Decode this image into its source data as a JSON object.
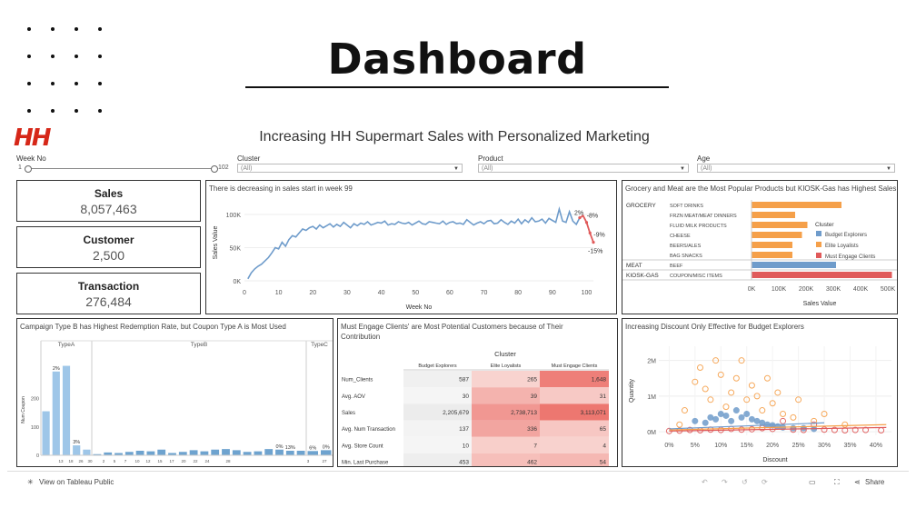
{
  "hero": {
    "title": "Dashboard"
  },
  "viz": {
    "brand": "HH",
    "title": "Increasing HH Supermart Sales with Personalized Marketing"
  },
  "filters": {
    "week": {
      "label": "Week No",
      "min": "1",
      "max": "102"
    },
    "cluster": {
      "label": "Cluster",
      "value": "(All)"
    },
    "product": {
      "label": "Product",
      "value": "(All)"
    },
    "age": {
      "label": "Age",
      "value": "(All)"
    }
  },
  "kpis": [
    {
      "label": "Sales",
      "value": "8,057,463"
    },
    {
      "label": "Customer",
      "value": "2,500"
    },
    {
      "label": "Transaction",
      "value": "276,484"
    }
  ],
  "line_panel": {
    "title": "There is decreasing in sales start in week 99"
  },
  "product_panel": {
    "title": "Grocery and Meat are the Most Popular Products but KIOSK-Gas has Highest Sales"
  },
  "campaign_panel": {
    "title": "Campaign Type B has Highest Redemption Rate, but Coupon Type A is Most Used"
  },
  "table_panel": {
    "title": "Must Engage Clients' are Most Potential Customers because of Their Contribution",
    "group_label": "Cluster",
    "columns": [
      "Budget Explorers",
      "Elite Loyalists",
      "Must Engage Clients"
    ],
    "rows": [
      {
        "label": "Num_Clients",
        "values": [
          "587",
          "265",
          "1,648"
        ]
      },
      {
        "label": "Avg. AOV",
        "values": [
          "30",
          "39",
          "31"
        ]
      },
      {
        "label": "Sales",
        "values": [
          "2,205,679",
          "2,738,713",
          "3,113,071"
        ]
      },
      {
        "label": "Avg. Num Transaction",
        "values": [
          "137",
          "336",
          "65"
        ]
      },
      {
        "label": "Avg. Store Count",
        "values": [
          "10",
          "7",
          "4"
        ]
      },
      {
        "label": "Min. Last Purchase",
        "values": [
          "453",
          "462",
          "54"
        ]
      }
    ]
  },
  "scatter_panel": {
    "title": "Increasing Discount Only Effective for Budget Explorers"
  },
  "toolbar": {
    "view_label": "View on Tableau Public",
    "share_label": "Share"
  },
  "colors": {
    "blue": "#6f9ccb",
    "orange": "#f5a04a",
    "red": "#e05a5a",
    "bar_light": "#9ec6e8",
    "bar_dark": "#5b8fbf"
  },
  "chart_data": [
    {
      "type": "line",
      "title": "There is decreasing in sales start in week 99",
      "xlabel": "Week No",
      "ylabel": "Sales Value",
      "xticks": [
        "0",
        "10",
        "20",
        "30",
        "40",
        "50",
        "60",
        "70",
        "80",
        "90",
        "100"
      ],
      "yticks": [
        "0K",
        "50K",
        "100K"
      ],
      "xlim": [
        0,
        102
      ],
      "ylim": [
        0,
        115000
      ],
      "x": [
        1,
        2,
        3,
        4,
        5,
        6,
        7,
        8,
        9,
        10,
        11,
        12,
        13,
        14,
        15,
        16,
        17,
        18,
        19,
        20,
        21,
        22,
        23,
        24,
        25,
        26,
        27,
        28,
        29,
        30,
        31,
        32,
        33,
        34,
        35,
        36,
        37,
        38,
        39,
        40,
        41,
        42,
        43,
        44,
        45,
        46,
        47,
        48,
        49,
        50,
        51,
        52,
        53,
        54,
        55,
        56,
        57,
        58,
        59,
        60,
        61,
        62,
        63,
        64,
        65,
        66,
        67,
        68,
        69,
        70,
        71,
        72,
        73,
        74,
        75,
        76,
        77,
        78,
        79,
        80,
        81,
        82,
        83,
        84,
        85,
        86,
        87,
        88,
        89,
        90,
        91,
        92,
        93,
        94,
        95,
        96,
        97,
        98,
        99,
        100,
        101,
        102
      ],
      "y": [
        3000,
        12000,
        18000,
        22000,
        25000,
        30000,
        35000,
        42000,
        50000,
        48000,
        58000,
        52000,
        62000,
        68000,
        66000,
        72000,
        78000,
        76000,
        80000,
        82000,
        78000,
        84000,
        80000,
        83000,
        86000,
        81000,
        85000,
        82000,
        88000,
        84000,
        80000,
        86000,
        83000,
        87000,
        85000,
        89000,
        84000,
        86000,
        88000,
        87000,
        90000,
        84000,
        86000,
        85000,
        89000,
        87000,
        86000,
        88000,
        84000,
        87000,
        90000,
        86000,
        85000,
        89000,
        88000,
        87000,
        86000,
        90000,
        85000,
        88000,
        89000,
        86000,
        87000,
        85000,
        92000,
        88000,
        84000,
        87000,
        89000,
        86000,
        90000,
        91000,
        86000,
        87000,
        92000,
        88000,
        85000,
        90000,
        87000,
        93000,
        86000,
        92000,
        88000,
        95000,
        89000,
        90000,
        93000,
        87000,
        94000,
        91000,
        88000,
        108000,
        90000,
        88000,
        104000,
        90000,
        85000,
        95000,
        98000,
        88000,
        72000,
        58000
      ],
      "annotations": [
        "2%",
        "-8%",
        "-9%",
        "-15%"
      ]
    },
    {
      "type": "bar",
      "title": "Grocery and Meat are the Most Popular Products but KIOSK-Gas has Highest Sales",
      "xlabel": "Sales Value",
      "xticks": [
        "0K",
        "100K",
        "200K",
        "300K",
        "400K",
        "500K"
      ],
      "xlim": [
        0,
        500000
      ],
      "legend_title": "Cluster",
      "legend": [
        "Budget Explorers",
        "Elite Loyalists",
        "Must Engage Clients"
      ],
      "legend_position": "right",
      "groups": [
        {
          "name": "GROCERY",
          "items": [
            {
              "label": "SOFT DRINKS",
              "value": 330000,
              "series": "Elite Loyalists"
            },
            {
              "label": "FRZN MEAT/MEAT DINNERS",
              "value": 160000,
              "series": "Elite Loyalists"
            },
            {
              "label": "FLUID MILK PRODUCTS",
              "value": 205000,
              "series": "Elite Loyalists"
            },
            {
              "label": "CHEESE",
              "value": 185000,
              "series": "Elite Loyalists"
            },
            {
              "label": "BEERS/ALES",
              "value": 150000,
              "series": "Elite Loyalists"
            },
            {
              "label": "BAG SNACKS",
              "value": 150000,
              "series": "Elite Loyalists"
            }
          ]
        },
        {
          "name": "MEAT",
          "items": [
            {
              "label": "BEEF",
              "value": 310000,
              "series": "Budget Explorers"
            }
          ]
        },
        {
          "name": "KIOSK-GAS",
          "items": [
            {
              "label": "COUPON/MISC ITEMS",
              "value": 515000,
              "series": "Must Engage Clients"
            }
          ]
        }
      ]
    },
    {
      "type": "bar",
      "title": "Campaign Type B has Highest Redemption Rate, but Coupon Type A is Most Used",
      "ylabel": "Num Coupon",
      "yticks": [
        "0",
        "100",
        "200"
      ],
      "ylim": [
        0,
        320
      ],
      "panels": [
        {
          "name": "TypeA",
          "categories": [
            "8",
            "13",
            "18",
            "26",
            "30"
          ],
          "values": [
            155,
            295,
            315,
            35,
            20
          ],
          "labels": {
            "1": "2%",
            "3": "3%"
          }
        },
        {
          "name": "TypeB",
          "categories": [
            "2",
            "5",
            "6",
            "7",
            "9",
            "10",
            "11",
            "12",
            "14",
            "15",
            "16",
            "17",
            "19",
            "20",
            "21",
            "22",
            "23",
            "24",
            "25",
            "28"
          ],
          "values": [
            4,
            10,
            8,
            12,
            16,
            14,
            20,
            8,
            12,
            18,
            14,
            20,
            22,
            18,
            12,
            14,
            22,
            20,
            16,
            16
          ],
          "labels": {
            "17": "0%",
            "18": "13%"
          }
        },
        {
          "name": "TypeC",
          "categories": [
            "3",
            "27"
          ],
          "values": [
            15,
            18
          ],
          "labels": {
            "0": "6%",
            "1": "0%"
          }
        }
      ],
      "visible_tick_labels": [
        "13",
        "18",
        "26",
        "30",
        "2",
        "5",
        "7",
        "10",
        "12",
        "15",
        "17",
        "20",
        "22",
        "24",
        "28",
        "3",
        "27"
      ]
    },
    {
      "type": "scatter",
      "title": "Increasing Discount Only Effective for Budget Explorers",
      "xlabel": "Discount",
      "ylabel": "Quantity",
      "xticks": [
        "0%",
        "5%",
        "10%",
        "15%",
        "20%",
        "25%",
        "30%",
        "35%",
        "40%"
      ],
      "yticks": [
        "0M",
        "1M",
        "2M"
      ],
      "xlim": [
        -0.02,
        0.43
      ],
      "ylim": [
        -0.1,
        2.4
      ],
      "series": [
        {
          "name": "Budget Explorers",
          "points": [
            [
              0.05,
              0.3
            ],
            [
              0.07,
              0.25
            ],
            [
              0.08,
              0.4
            ],
            [
              0.09,
              0.35
            ],
            [
              0.1,
              0.5
            ],
            [
              0.11,
              0.45
            ],
            [
              0.12,
              0.3
            ],
            [
              0.13,
              0.6
            ],
            [
              0.14,
              0.4
            ],
            [
              0.15,
              0.5
            ],
            [
              0.16,
              0.35
            ],
            [
              0.17,
              0.3
            ],
            [
              0.18,
              0.25
            ],
            [
              0.19,
              0.2
            ],
            [
              0.2,
              0.18
            ],
            [
              0.21,
              0.15
            ],
            [
              0.22,
              0.12
            ],
            [
              0.24,
              0.1
            ],
            [
              0.26,
              0.1
            ],
            [
              0.28,
              0.08
            ]
          ]
        },
        {
          "name": "Elite Loyalists",
          "points": [
            [
              0.02,
              0.2
            ],
            [
              0.03,
              0.6
            ],
            [
              0.05,
              1.4
            ],
            [
              0.06,
              1.8
            ],
            [
              0.07,
              1.2
            ],
            [
              0.08,
              0.9
            ],
            [
              0.09,
              2.0
            ],
            [
              0.1,
              1.6
            ],
            [
              0.11,
              0.7
            ],
            [
              0.12,
              1.1
            ],
            [
              0.13,
              1.5
            ],
            [
              0.14,
              2.0
            ],
            [
              0.15,
              0.9
            ],
            [
              0.16,
              1.3
            ],
            [
              0.17,
              1.0
            ],
            [
              0.18,
              0.6
            ],
            [
              0.19,
              1.5
            ],
            [
              0.2,
              0.8
            ],
            [
              0.21,
              1.1
            ],
            [
              0.22,
              0.5
            ],
            [
              0.24,
              0.4
            ],
            [
              0.25,
              0.9
            ],
            [
              0.28,
              0.3
            ],
            [
              0.3,
              0.5
            ],
            [
              0.34,
              0.2
            ]
          ]
        },
        {
          "name": "Must Engage Clients",
          "points": [
            [
              0.0,
              0.02
            ],
            [
              0.02,
              0.03
            ],
            [
              0.04,
              0.05
            ],
            [
              0.06,
              0.04
            ],
            [
              0.08,
              0.06
            ],
            [
              0.1,
              0.05
            ],
            [
              0.12,
              0.08
            ],
            [
              0.14,
              0.06
            ],
            [
              0.16,
              0.07
            ],
            [
              0.18,
              0.1
            ],
            [
              0.2,
              0.08
            ],
            [
              0.22,
              0.3
            ],
            [
              0.24,
              0.06
            ],
            [
              0.26,
              0.05
            ],
            [
              0.28,
              0.2
            ],
            [
              0.3,
              0.06
            ],
            [
              0.32,
              0.05
            ],
            [
              0.34,
              0.04
            ],
            [
              0.36,
              0.05
            ],
            [
              0.38,
              0.05
            ],
            [
              0.41,
              0.04
            ]
          ]
        }
      ]
    }
  ]
}
